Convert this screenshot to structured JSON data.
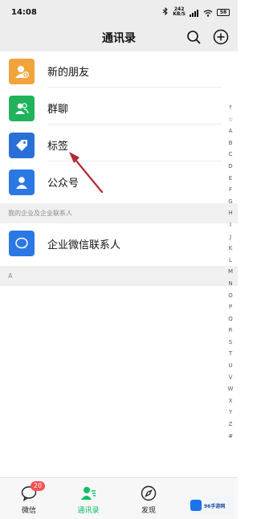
{
  "status_bar": {
    "time": "14:08",
    "bluetooth_icon": "bluetooth-icon",
    "speed_top": "242",
    "speed_bottom": "KB/S",
    "signal_icon": "signal-icon",
    "wifi_icon": "wifi-icon",
    "battery": "58"
  },
  "header": {
    "title": "通讯录",
    "search_icon": "search-icon",
    "add_icon": "plus-circle-icon"
  },
  "contacts_rows": [
    {
      "label": "新的朋友",
      "icon": "add-friend-icon",
      "color": "#f1a33c"
    },
    {
      "label": "群聊",
      "icon": "group-chat-icon",
      "color": "#21b35c"
    },
    {
      "label": "标签",
      "icon": "tag-icon",
      "color": "#2b6fd6"
    },
    {
      "label": "公众号",
      "icon": "official-account-icon",
      "color": "#2b78e4"
    }
  ],
  "sections": {
    "enterprise_header": "我的企业及企业联系人",
    "enterprise_row": {
      "label": "企业微信联系人",
      "icon": "work-wechat-icon",
      "color": "#2b78e4"
    },
    "letter_header": "A"
  },
  "index_letters": [
    "↑",
    "☆",
    "A",
    "B",
    "C",
    "D",
    "E",
    "F",
    "G",
    "H",
    "I",
    "J",
    "K",
    "L",
    "M",
    "N",
    "O",
    "P",
    "Q",
    "R",
    "S",
    "T",
    "U",
    "V",
    "W",
    "X",
    "Y",
    "Z",
    "#"
  ],
  "bottom_nav": {
    "items": [
      {
        "label": "微信",
        "icon": "chat-bubble-icon",
        "badge": "20"
      },
      {
        "label": "通讯录",
        "icon": "contacts-icon",
        "active": true
      },
      {
        "label": "发现",
        "icon": "compass-icon"
      }
    ]
  },
  "watermark": {
    "text": "96手游网",
    "logo": "site-logo-icon"
  },
  "colors": {
    "accent": "#07c160",
    "badge": "#fa5151",
    "annotation_arrow": "#b3283a",
    "header_bg": "#ededed"
  }
}
